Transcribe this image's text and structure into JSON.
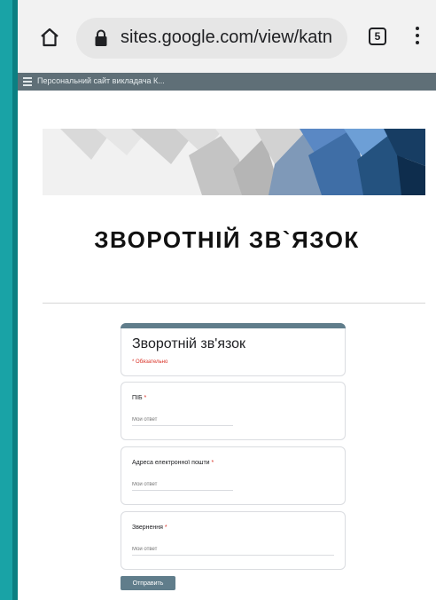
{
  "browser": {
    "url": "sites.google.com/view/katn",
    "tab_count": "5"
  },
  "site": {
    "title": "Персональний сайт викладача К..."
  },
  "page": {
    "heading": "ЗВОРОТНІЙ ЗВ`ЯЗОК"
  },
  "form": {
    "title": "Зворотній зв'язок",
    "required_note": "* Обязательно",
    "questions": [
      {
        "label": "ПІБ",
        "required": "*",
        "placeholder": "Мой ответ"
      },
      {
        "label": "Адреса електронної пошти",
        "required": "*",
        "placeholder": "Мой ответ"
      },
      {
        "label": "Звернення",
        "required": "*",
        "placeholder": "Мой ответ"
      }
    ],
    "submit_label": "Отправить"
  },
  "colors": {
    "frame": "#19a3a6",
    "nav_bar": "#5f6f77",
    "form_accent": "#607d8b",
    "required": "#d93025"
  }
}
